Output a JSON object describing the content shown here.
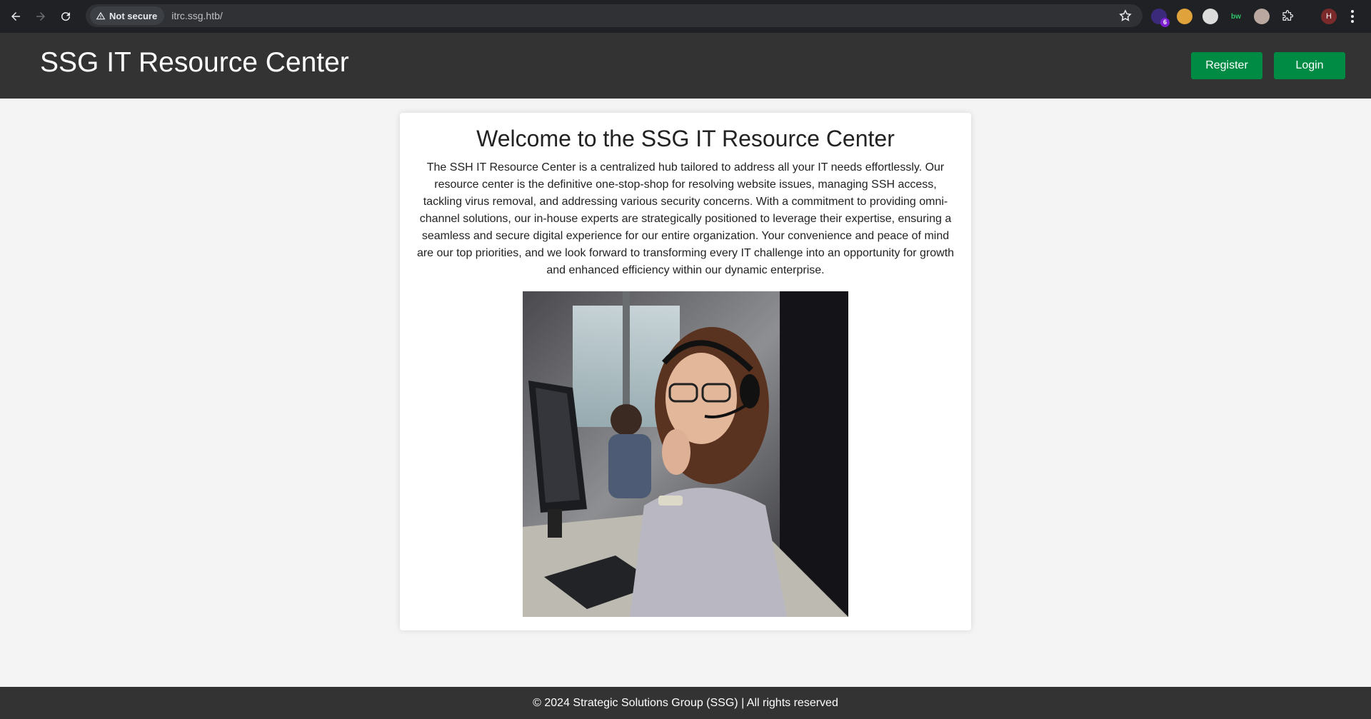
{
  "browser": {
    "security_label": "Not secure",
    "url": "itrc.ssg.htb/",
    "extension_badge": "6",
    "ext_label": "bw",
    "profile_initial": "H",
    "icons": [
      "back-icon",
      "forward-icon",
      "reload-icon",
      "warning-icon",
      "star-icon",
      "puzzle-icon",
      "more-icon"
    ]
  },
  "header": {
    "title": "SSG IT Resource Center",
    "register_label": "Register",
    "login_label": "Login"
  },
  "main": {
    "heading": "Welcome to the SSG IT Resource Center",
    "body": "The SSH IT Resource Center is a centralized hub tailored to address all your IT needs effortlessly. Our resource center is the definitive one-stop-shop for resolving website issues, managing SSH access, tackling virus removal, and addressing various security concerns. With a commitment to providing omni-channel solutions, our in-house experts are strategically positioned to leverage their expertise, ensuring a seamless and secure digital experience for our entire organization. Your convenience and peace of mind are our top priorities, and we look forward to transforming every IT challenge into an opportunity for growth and enhanced efficiency within our dynamic enterprise."
  },
  "footer": {
    "text": "© 2024 Strategic Solutions Group (SSG) | All rights reserved"
  },
  "colors": {
    "header_bg": "#333333",
    "button_green": "#008b45",
    "page_bg": "#f4f4f4",
    "chrome_bg": "#202124"
  }
}
